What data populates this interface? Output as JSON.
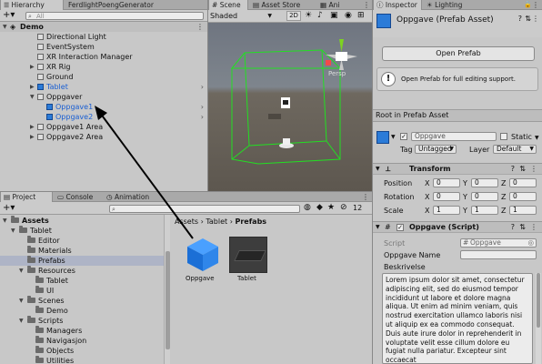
{
  "hierarchy": {
    "tabs": [
      "Hierarchy",
      "FerdlightPoengGenerator"
    ],
    "search_placeholder": "All",
    "scene_name": "Demo",
    "items": [
      {
        "label": "Directional Light"
      },
      {
        "label": "EventSystem"
      },
      {
        "label": "XR Interaction Manager"
      },
      {
        "label": "XR Rig"
      },
      {
        "label": "Ground"
      },
      {
        "label": "Tablet"
      },
      {
        "label": "Oppgaver"
      },
      {
        "label": "Oppgave1"
      },
      {
        "label": "Oppgave2"
      },
      {
        "label": "Oppgave1 Area"
      },
      {
        "label": "Oppgave2 Area"
      }
    ]
  },
  "scene_view": {
    "tabs": [
      "Scene",
      "Asset Store",
      "Ani"
    ],
    "shading_mode": "Shaded",
    "mode_2d": "2D",
    "persp_label": "Persp"
  },
  "project": {
    "tabs": [
      "Project",
      "Console",
      "Animation"
    ],
    "badge_count": "12",
    "breadcrumb": [
      "Assets",
      "Tablet",
      "Prefabs"
    ],
    "tree": [
      {
        "label": "Assets"
      },
      {
        "label": "Tablet"
      },
      {
        "label": "Editor"
      },
      {
        "label": "Materials"
      },
      {
        "label": "Prefabs"
      },
      {
        "label": "Resources"
      },
      {
        "label": "Tablet"
      },
      {
        "label": "UI"
      },
      {
        "label": "Scenes"
      },
      {
        "label": "Demo"
      },
      {
        "label": "Scripts"
      },
      {
        "label": "Managers"
      },
      {
        "label": "Navigasjon"
      },
      {
        "label": "Objects"
      },
      {
        "label": "Utilities"
      }
    ],
    "assets": [
      {
        "label": "Oppgave"
      },
      {
        "label": "Tablet"
      }
    ]
  },
  "inspector": {
    "tabs": [
      "Inspector",
      "Lighting"
    ],
    "title": "Oppgave (Prefab Asset)",
    "open_prefab_label": "Open Prefab",
    "open_prefab_info": "Open Prefab for full editing support.",
    "root_label": "Root in Prefab Asset",
    "object_name": "Oppgave",
    "static_label": "Static",
    "tag_label": "Tag",
    "tag_value": "Untagged",
    "layer_label": "Layer",
    "layer_value": "Default",
    "transform": {
      "title": "Transform",
      "rows": [
        {
          "label": "Position",
          "x": "0",
          "y": "0",
          "z": "0"
        },
        {
          "label": "Rotation",
          "x": "0",
          "y": "0",
          "z": "0"
        },
        {
          "label": "Scale",
          "x": "1",
          "y": "1",
          "z": "1"
        }
      ]
    },
    "script": {
      "title": "Oppgave (Script)",
      "script_label": "Script",
      "script_value": "Oppgave",
      "name_label": "Oppgave Name",
      "desc_label": "Beskrivelse",
      "desc_text": "Lorem ipsum dolor sit amet, consectetur adipiscing elit, sed do eiusmod tempor incididunt ut labore et dolore magna aliqua. Ut enim ad minim veniam, quis nostrud exercitation ullamco laboris nisi ut aliquip ex ea commodo consequat. Duis aute irure dolor in reprehenderit in voluptate velit esse cillum dolore eu fugiat nulla pariatur. Excepteur sint occaecat"
    },
    "axis": {
      "x": "X",
      "y": "Y",
      "z": "Z"
    }
  }
}
